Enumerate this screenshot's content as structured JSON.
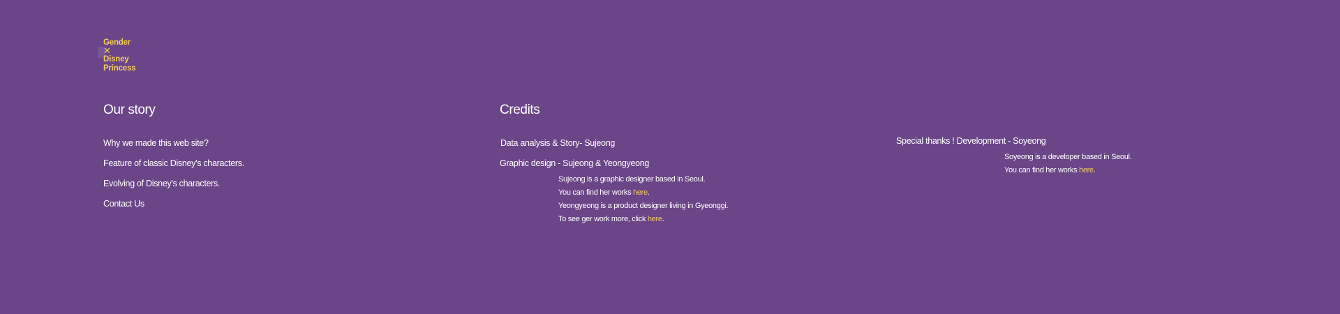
{
  "logo": {
    "line1": "Gender",
    "x": "✕",
    "line2": "Disney",
    "line3": "Princess"
  },
  "story": {
    "heading": "Our story",
    "links": [
      "Why we made this web site?",
      "Feature of classic Disney's characters.",
      "Evolving of Disney's characters.",
      "Contact Us"
    ]
  },
  "credits": {
    "heading": "Credits",
    "data_analysis": "Data analysis & Story- Sujeong",
    "graphic_design": "Graphic design - Sujeong & Yeongyeong",
    "bio_sujeong": "Sujeong is a graphic designer based in Seoul.",
    "bio_sujeong_works_prefix": "You can find her works ",
    "bio_sujeong_works_link": "here",
    "bio_sujeong_works_suffix": ".",
    "bio_yeongyeong": "Yeongyeong is a product designer living in Gyeonggi.",
    "bio_yeongyeong_works_prefix": "To see ger work more, click ",
    "bio_yeongyeong_works_link": "here",
    "bio_yeongyeong_works_suffix": ".",
    "special_thanks": "Special thanks ! Development - Soyeong",
    "bio_soyeong": "Soyeong is a developer based in Seoul.",
    "bio_soyeong_works_prefix": "You can find her works ",
    "bio_soyeong_works_link": "here",
    "bio_soyeong_works_suffix": "."
  },
  "colors": {
    "background": "#6a4587",
    "accent": "#f5cf57",
    "text": "#ffffff"
  }
}
